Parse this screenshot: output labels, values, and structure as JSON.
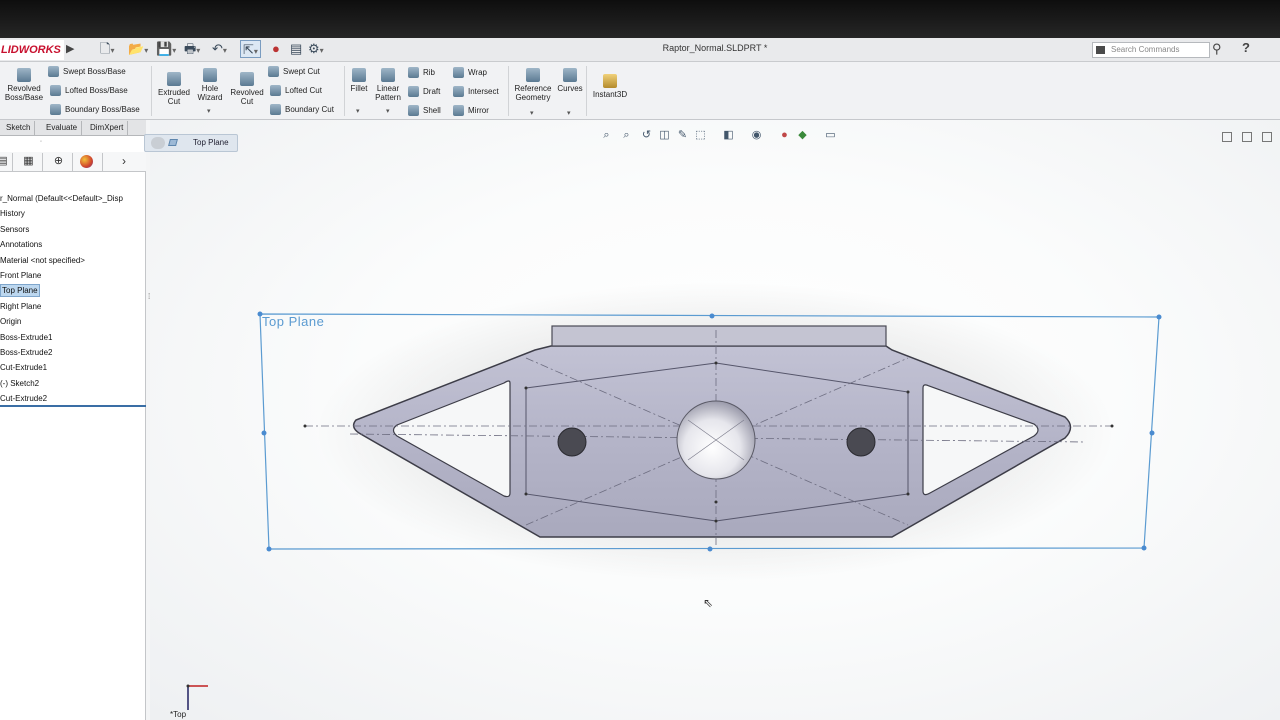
{
  "app": {
    "logo_text": "LIDWORKS",
    "document_title": "Raptor_Normal.SLDPRT *",
    "search_placeholder": "Search Commands"
  },
  "command_manager": {
    "revolved_boss": "Revolved\nBoss/Base",
    "swept_boss": "Swept Boss/Base",
    "lofted_boss": "Lofted Boss/Base",
    "boundary_boss": "Boundary Boss/Base",
    "extruded_cut": "Extruded\nCut",
    "hole_wizard": "Hole\nWizard",
    "revolved_cut": "Revolved\nCut",
    "swept_cut": "Swept Cut",
    "lofted_cut": "Lofted Cut",
    "boundary_cut": "Boundary Cut",
    "fillet": "Fillet",
    "linear_pattern": "Linear\nPattern",
    "rib": "Rib",
    "draft": "Draft",
    "shell": "Shell",
    "wrap": "Wrap",
    "intersect": "Intersect",
    "mirror": "Mirror",
    "reference_geometry": "Reference\nGeometry",
    "curves": "Curves",
    "instant3d": "Instant3D"
  },
  "tabs": [
    "Sketch",
    "Evaluate",
    "DimXpert"
  ],
  "feature_tree": {
    "items": [
      {
        "label": "r_Normal  (Default<<Default>_Disp",
        "selected": false
      },
      {
        "label": "History",
        "selected": false
      },
      {
        "label": "Sensors",
        "selected": false
      },
      {
        "label": "Annotations",
        "selected": false
      },
      {
        "label": "Material <not specified>",
        "selected": false
      },
      {
        "label": "Front Plane",
        "selected": false
      },
      {
        "label": "Top Plane",
        "selected": true
      },
      {
        "label": "Right Plane",
        "selected": false
      },
      {
        "label": "Origin",
        "selected": false
      },
      {
        "label": "Boss-Extrude1",
        "selected": false
      },
      {
        "label": "Boss-Extrude2",
        "selected": false
      },
      {
        "label": "Cut-Extrude1",
        "selected": false
      },
      {
        "label": "(-) Sketch2",
        "selected": false
      },
      {
        "label": "Cut-Extrude2",
        "selected": false
      }
    ]
  },
  "viewport": {
    "breadcrumb_label": "Top Plane",
    "plane_label": "Top Plane",
    "triad_label": "*Top",
    "plane_color": "#5b9bd1",
    "part_color": "#b4b4c8"
  }
}
